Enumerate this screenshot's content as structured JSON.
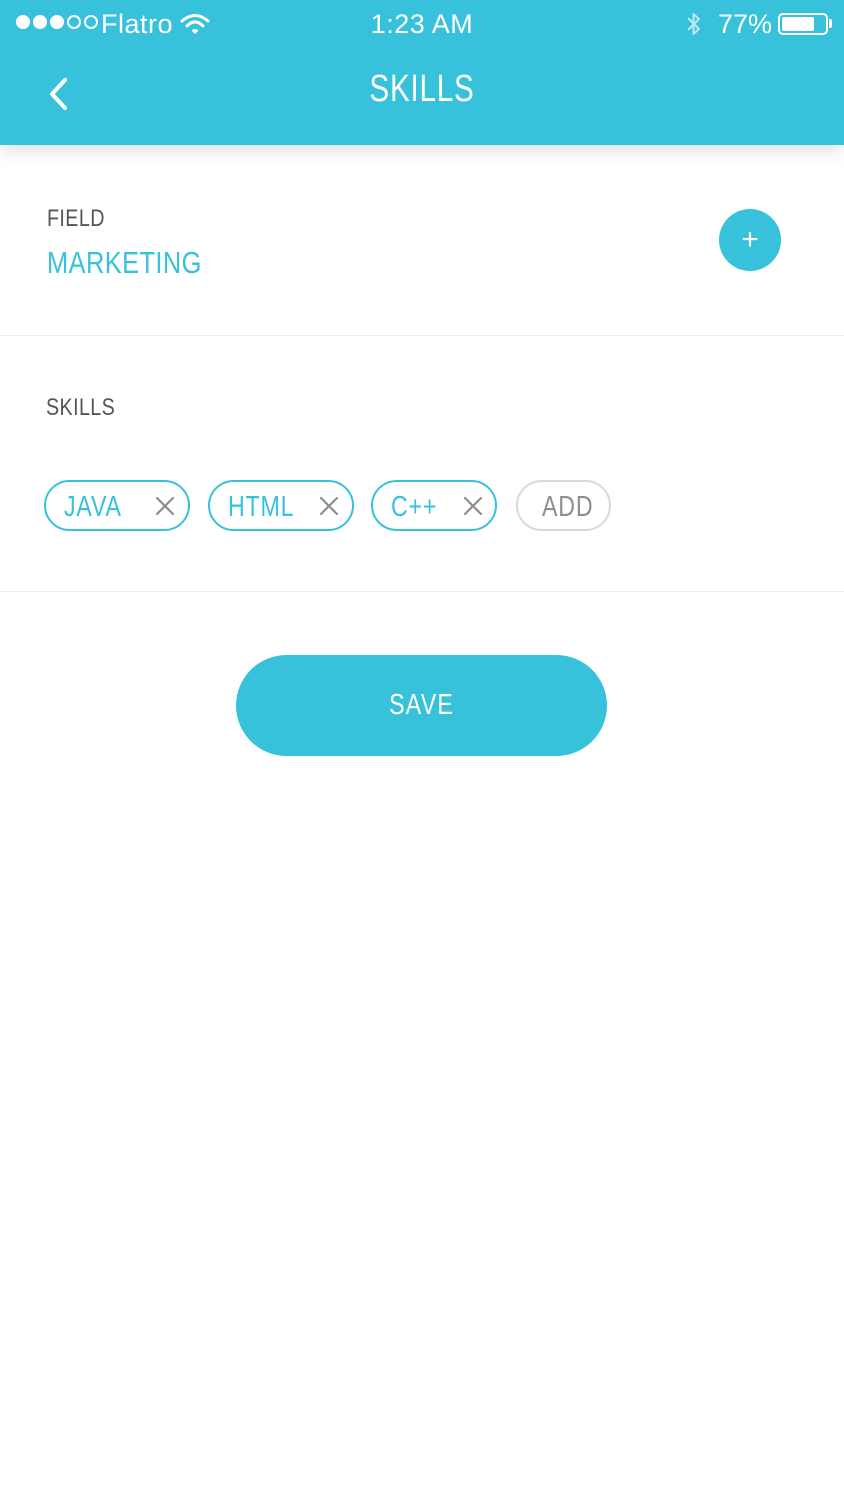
{
  "status_bar": {
    "carrier": "Flatro",
    "time": "1:23 AM",
    "battery_percent": "77%",
    "battery_level": 0.77,
    "signal_bars_filled": 3,
    "signal_bars_total": 5
  },
  "nav": {
    "title": "SKILLS"
  },
  "field_section": {
    "label": "FIELD",
    "value": "MARKETING",
    "add_symbol": "+"
  },
  "skills_section": {
    "label": "SKILLS",
    "chips": [
      {
        "label": "JAVA"
      },
      {
        "label": "HTML"
      },
      {
        "label": "C++"
      }
    ],
    "add_label": "ADD"
  },
  "actions": {
    "save_label": "SAVE"
  },
  "colors": {
    "accent": "#37c1da",
    "text_dark": "#555555",
    "text_muted": "#8e8e8e",
    "divider": "#ececec"
  },
  "icons": {
    "back": "chevron-left-icon",
    "wifi": "wifi-icon",
    "bluetooth": "bluetooth-icon",
    "remove": "close-icon"
  }
}
